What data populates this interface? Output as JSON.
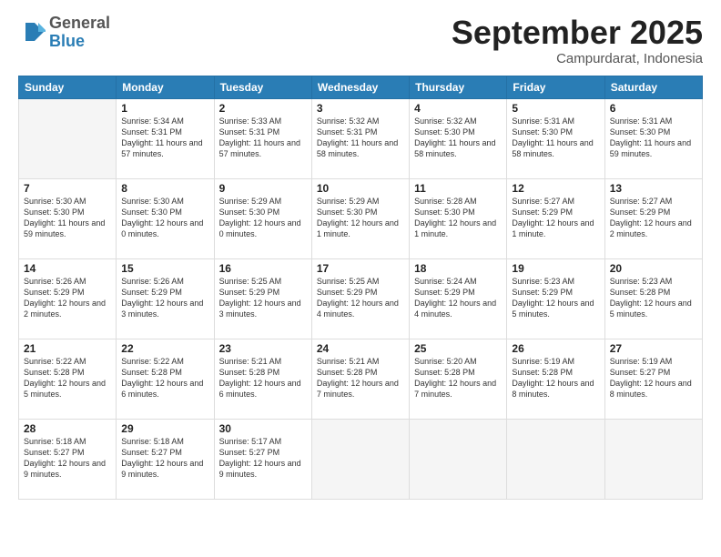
{
  "logo": {
    "general": "General",
    "blue": "Blue"
  },
  "header": {
    "month": "September 2025",
    "location": "Campurdarat, Indonesia"
  },
  "days_of_week": [
    "Sunday",
    "Monday",
    "Tuesday",
    "Wednesday",
    "Thursday",
    "Friday",
    "Saturday"
  ],
  "weeks": [
    [
      {
        "day": "",
        "info": ""
      },
      {
        "day": "1",
        "info": "Sunrise: 5:34 AM\nSunset: 5:31 PM\nDaylight: 11 hours\nand 57 minutes."
      },
      {
        "day": "2",
        "info": "Sunrise: 5:33 AM\nSunset: 5:31 PM\nDaylight: 11 hours\nand 57 minutes."
      },
      {
        "day": "3",
        "info": "Sunrise: 5:32 AM\nSunset: 5:31 PM\nDaylight: 11 hours\nand 58 minutes."
      },
      {
        "day": "4",
        "info": "Sunrise: 5:32 AM\nSunset: 5:30 PM\nDaylight: 11 hours\nand 58 minutes."
      },
      {
        "day": "5",
        "info": "Sunrise: 5:31 AM\nSunset: 5:30 PM\nDaylight: 11 hours\nand 58 minutes."
      },
      {
        "day": "6",
        "info": "Sunrise: 5:31 AM\nSunset: 5:30 PM\nDaylight: 11 hours\nand 59 minutes."
      }
    ],
    [
      {
        "day": "7",
        "info": "Sunrise: 5:30 AM\nSunset: 5:30 PM\nDaylight: 11 hours\nand 59 minutes."
      },
      {
        "day": "8",
        "info": "Sunrise: 5:30 AM\nSunset: 5:30 PM\nDaylight: 12 hours\nand 0 minutes."
      },
      {
        "day": "9",
        "info": "Sunrise: 5:29 AM\nSunset: 5:30 PM\nDaylight: 12 hours\nand 0 minutes."
      },
      {
        "day": "10",
        "info": "Sunrise: 5:29 AM\nSunset: 5:30 PM\nDaylight: 12 hours\nand 1 minute."
      },
      {
        "day": "11",
        "info": "Sunrise: 5:28 AM\nSunset: 5:30 PM\nDaylight: 12 hours\nand 1 minute."
      },
      {
        "day": "12",
        "info": "Sunrise: 5:27 AM\nSunset: 5:29 PM\nDaylight: 12 hours\nand 1 minute."
      },
      {
        "day": "13",
        "info": "Sunrise: 5:27 AM\nSunset: 5:29 PM\nDaylight: 12 hours\nand 2 minutes."
      }
    ],
    [
      {
        "day": "14",
        "info": "Sunrise: 5:26 AM\nSunset: 5:29 PM\nDaylight: 12 hours\nand 2 minutes."
      },
      {
        "day": "15",
        "info": "Sunrise: 5:26 AM\nSunset: 5:29 PM\nDaylight: 12 hours\nand 3 minutes."
      },
      {
        "day": "16",
        "info": "Sunrise: 5:25 AM\nSunset: 5:29 PM\nDaylight: 12 hours\nand 3 minutes."
      },
      {
        "day": "17",
        "info": "Sunrise: 5:25 AM\nSunset: 5:29 PM\nDaylight: 12 hours\nand 4 minutes."
      },
      {
        "day": "18",
        "info": "Sunrise: 5:24 AM\nSunset: 5:29 PM\nDaylight: 12 hours\nand 4 minutes."
      },
      {
        "day": "19",
        "info": "Sunrise: 5:23 AM\nSunset: 5:29 PM\nDaylight: 12 hours\nand 5 minutes."
      },
      {
        "day": "20",
        "info": "Sunrise: 5:23 AM\nSunset: 5:28 PM\nDaylight: 12 hours\nand 5 minutes."
      }
    ],
    [
      {
        "day": "21",
        "info": "Sunrise: 5:22 AM\nSunset: 5:28 PM\nDaylight: 12 hours\nand 5 minutes."
      },
      {
        "day": "22",
        "info": "Sunrise: 5:22 AM\nSunset: 5:28 PM\nDaylight: 12 hours\nand 6 minutes."
      },
      {
        "day": "23",
        "info": "Sunrise: 5:21 AM\nSunset: 5:28 PM\nDaylight: 12 hours\nand 6 minutes."
      },
      {
        "day": "24",
        "info": "Sunrise: 5:21 AM\nSunset: 5:28 PM\nDaylight: 12 hours\nand 7 minutes."
      },
      {
        "day": "25",
        "info": "Sunrise: 5:20 AM\nSunset: 5:28 PM\nDaylight: 12 hours\nand 7 minutes."
      },
      {
        "day": "26",
        "info": "Sunrise: 5:19 AM\nSunset: 5:28 PM\nDaylight: 12 hours\nand 8 minutes."
      },
      {
        "day": "27",
        "info": "Sunrise: 5:19 AM\nSunset: 5:27 PM\nDaylight: 12 hours\nand 8 minutes."
      }
    ],
    [
      {
        "day": "28",
        "info": "Sunrise: 5:18 AM\nSunset: 5:27 PM\nDaylight: 12 hours\nand 9 minutes."
      },
      {
        "day": "29",
        "info": "Sunrise: 5:18 AM\nSunset: 5:27 PM\nDaylight: 12 hours\nand 9 minutes."
      },
      {
        "day": "30",
        "info": "Sunrise: 5:17 AM\nSunset: 5:27 PM\nDaylight: 12 hours\nand 9 minutes."
      },
      {
        "day": "",
        "info": ""
      },
      {
        "day": "",
        "info": ""
      },
      {
        "day": "",
        "info": ""
      },
      {
        "day": "",
        "info": ""
      }
    ]
  ]
}
